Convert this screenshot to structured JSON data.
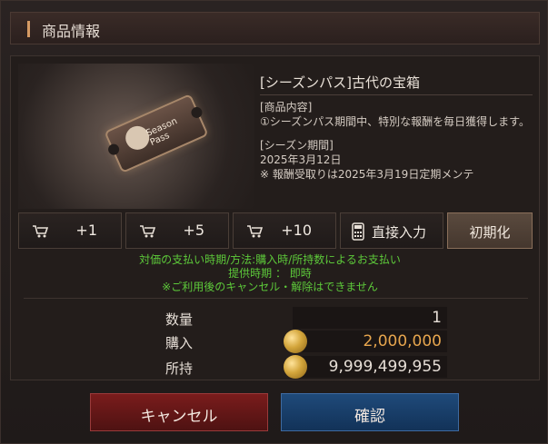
{
  "dialog": {
    "title": "商品情報"
  },
  "item": {
    "name": "[シーズンパス]古代の宝箱",
    "image_text": "Season Pass",
    "content_heading": "[商品内容]",
    "content_body": "①シーズンパス期間中、特別な報酬を毎日獲得します。",
    "period_heading": "[シーズン期間]",
    "period_date": "2025年3月12日",
    "period_note": "※ 報酬受取りは2025年3月19日定期メンテ"
  },
  "quantity_buttons": [
    {
      "label": "+1",
      "icon": "cart-icon"
    },
    {
      "label": "+5",
      "icon": "cart-icon"
    },
    {
      "label": "+10",
      "icon": "cart-icon"
    }
  ],
  "direct_input": {
    "label": "直接入力",
    "icon": "calculator-icon"
  },
  "reset": {
    "label": "初期化"
  },
  "notice": {
    "line1": "対価の支払い時期/方法:購入時/所持数によるお支払い",
    "line2": "提供時期 ： 即時",
    "line3": "※ご利用後のキャンセル・解除はできません",
    "color": "#5dc93a"
  },
  "summary": {
    "quantity_label": "数量",
    "quantity_value": "1",
    "purchase_label": "購入",
    "purchase_value": "2,000,000",
    "owned_label": "所持",
    "owned_value": "9,999,499,955",
    "currency_icon": "gold-coin-icon"
  },
  "actions": {
    "cancel_label": "キャンセル",
    "confirm_label": "確認"
  },
  "colors": {
    "cancel": "#7a1c1c",
    "confirm": "#1f4a7a",
    "price": "#e7a64e"
  }
}
